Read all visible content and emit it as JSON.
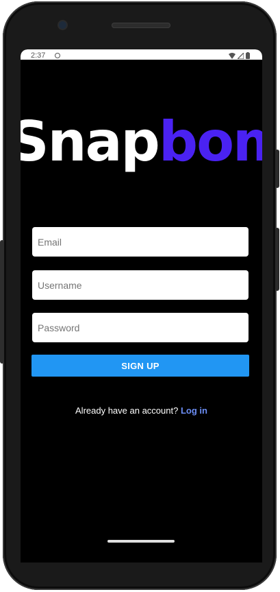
{
  "status_bar": {
    "time": "2:37",
    "icons": [
      "app-notification-icon",
      "wifi-icon",
      "cellular-icon",
      "battery-icon"
    ]
  },
  "logo": {
    "part_1": "Snap",
    "part_2": "bomb",
    "color_1": "#ffffff",
    "color_2": "#4a22f2"
  },
  "form": {
    "email_placeholder": "Email",
    "username_placeholder": "Username",
    "password_placeholder": "Password",
    "signup_label": "SIGN UP"
  },
  "footer": {
    "prompt": "Already have an account?",
    "login_label": "Log in"
  },
  "colors": {
    "background": "#000000",
    "button": "#2196f3",
    "link": "#6c8ef5"
  }
}
